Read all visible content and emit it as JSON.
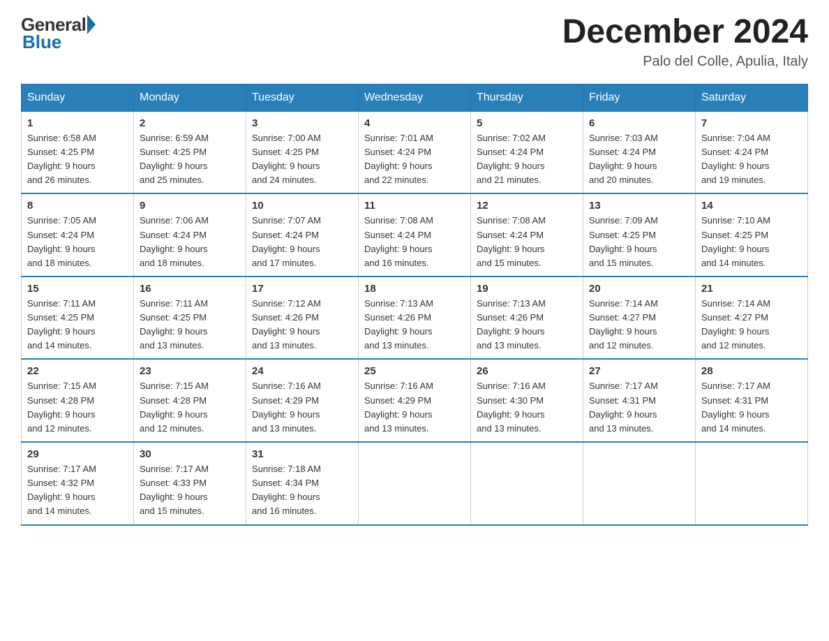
{
  "header": {
    "logo_general": "General",
    "logo_blue": "Blue",
    "month_title": "December 2024",
    "location": "Palo del Colle, Apulia, Italy"
  },
  "days_of_week": [
    "Sunday",
    "Monday",
    "Tuesday",
    "Wednesday",
    "Thursday",
    "Friday",
    "Saturday"
  ],
  "weeks": [
    [
      {
        "day": "1",
        "sunrise": "6:58 AM",
        "sunset": "4:25 PM",
        "daylight": "9 hours and 26 minutes."
      },
      {
        "day": "2",
        "sunrise": "6:59 AM",
        "sunset": "4:25 PM",
        "daylight": "9 hours and 25 minutes."
      },
      {
        "day": "3",
        "sunrise": "7:00 AM",
        "sunset": "4:25 PM",
        "daylight": "9 hours and 24 minutes."
      },
      {
        "day": "4",
        "sunrise": "7:01 AM",
        "sunset": "4:24 PM",
        "daylight": "9 hours and 22 minutes."
      },
      {
        "day": "5",
        "sunrise": "7:02 AM",
        "sunset": "4:24 PM",
        "daylight": "9 hours and 21 minutes."
      },
      {
        "day": "6",
        "sunrise": "7:03 AM",
        "sunset": "4:24 PM",
        "daylight": "9 hours and 20 minutes."
      },
      {
        "day": "7",
        "sunrise": "7:04 AM",
        "sunset": "4:24 PM",
        "daylight": "9 hours and 19 minutes."
      }
    ],
    [
      {
        "day": "8",
        "sunrise": "7:05 AM",
        "sunset": "4:24 PM",
        "daylight": "9 hours and 18 minutes."
      },
      {
        "day": "9",
        "sunrise": "7:06 AM",
        "sunset": "4:24 PM",
        "daylight": "9 hours and 18 minutes."
      },
      {
        "day": "10",
        "sunrise": "7:07 AM",
        "sunset": "4:24 PM",
        "daylight": "9 hours and 17 minutes."
      },
      {
        "day": "11",
        "sunrise": "7:08 AM",
        "sunset": "4:24 PM",
        "daylight": "9 hours and 16 minutes."
      },
      {
        "day": "12",
        "sunrise": "7:08 AM",
        "sunset": "4:24 PM",
        "daylight": "9 hours and 15 minutes."
      },
      {
        "day": "13",
        "sunrise": "7:09 AM",
        "sunset": "4:25 PM",
        "daylight": "9 hours and 15 minutes."
      },
      {
        "day": "14",
        "sunrise": "7:10 AM",
        "sunset": "4:25 PM",
        "daylight": "9 hours and 14 minutes."
      }
    ],
    [
      {
        "day": "15",
        "sunrise": "7:11 AM",
        "sunset": "4:25 PM",
        "daylight": "9 hours and 14 minutes."
      },
      {
        "day": "16",
        "sunrise": "7:11 AM",
        "sunset": "4:25 PM",
        "daylight": "9 hours and 13 minutes."
      },
      {
        "day": "17",
        "sunrise": "7:12 AM",
        "sunset": "4:26 PM",
        "daylight": "9 hours and 13 minutes."
      },
      {
        "day": "18",
        "sunrise": "7:13 AM",
        "sunset": "4:26 PM",
        "daylight": "9 hours and 13 minutes."
      },
      {
        "day": "19",
        "sunrise": "7:13 AM",
        "sunset": "4:26 PM",
        "daylight": "9 hours and 13 minutes."
      },
      {
        "day": "20",
        "sunrise": "7:14 AM",
        "sunset": "4:27 PM",
        "daylight": "9 hours and 12 minutes."
      },
      {
        "day": "21",
        "sunrise": "7:14 AM",
        "sunset": "4:27 PM",
        "daylight": "9 hours and 12 minutes."
      }
    ],
    [
      {
        "day": "22",
        "sunrise": "7:15 AM",
        "sunset": "4:28 PM",
        "daylight": "9 hours and 12 minutes."
      },
      {
        "day": "23",
        "sunrise": "7:15 AM",
        "sunset": "4:28 PM",
        "daylight": "9 hours and 12 minutes."
      },
      {
        "day": "24",
        "sunrise": "7:16 AM",
        "sunset": "4:29 PM",
        "daylight": "9 hours and 13 minutes."
      },
      {
        "day": "25",
        "sunrise": "7:16 AM",
        "sunset": "4:29 PM",
        "daylight": "9 hours and 13 minutes."
      },
      {
        "day": "26",
        "sunrise": "7:16 AM",
        "sunset": "4:30 PM",
        "daylight": "9 hours and 13 minutes."
      },
      {
        "day": "27",
        "sunrise": "7:17 AM",
        "sunset": "4:31 PM",
        "daylight": "9 hours and 13 minutes."
      },
      {
        "day": "28",
        "sunrise": "7:17 AM",
        "sunset": "4:31 PM",
        "daylight": "9 hours and 14 minutes."
      }
    ],
    [
      {
        "day": "29",
        "sunrise": "7:17 AM",
        "sunset": "4:32 PM",
        "daylight": "9 hours and 14 minutes."
      },
      {
        "day": "30",
        "sunrise": "7:17 AM",
        "sunset": "4:33 PM",
        "daylight": "9 hours and 15 minutes."
      },
      {
        "day": "31",
        "sunrise": "7:18 AM",
        "sunset": "4:34 PM",
        "daylight": "9 hours and 16 minutes."
      },
      null,
      null,
      null,
      null
    ]
  ],
  "labels": {
    "sunrise": "Sunrise:",
    "sunset": "Sunset:",
    "daylight": "Daylight:"
  }
}
